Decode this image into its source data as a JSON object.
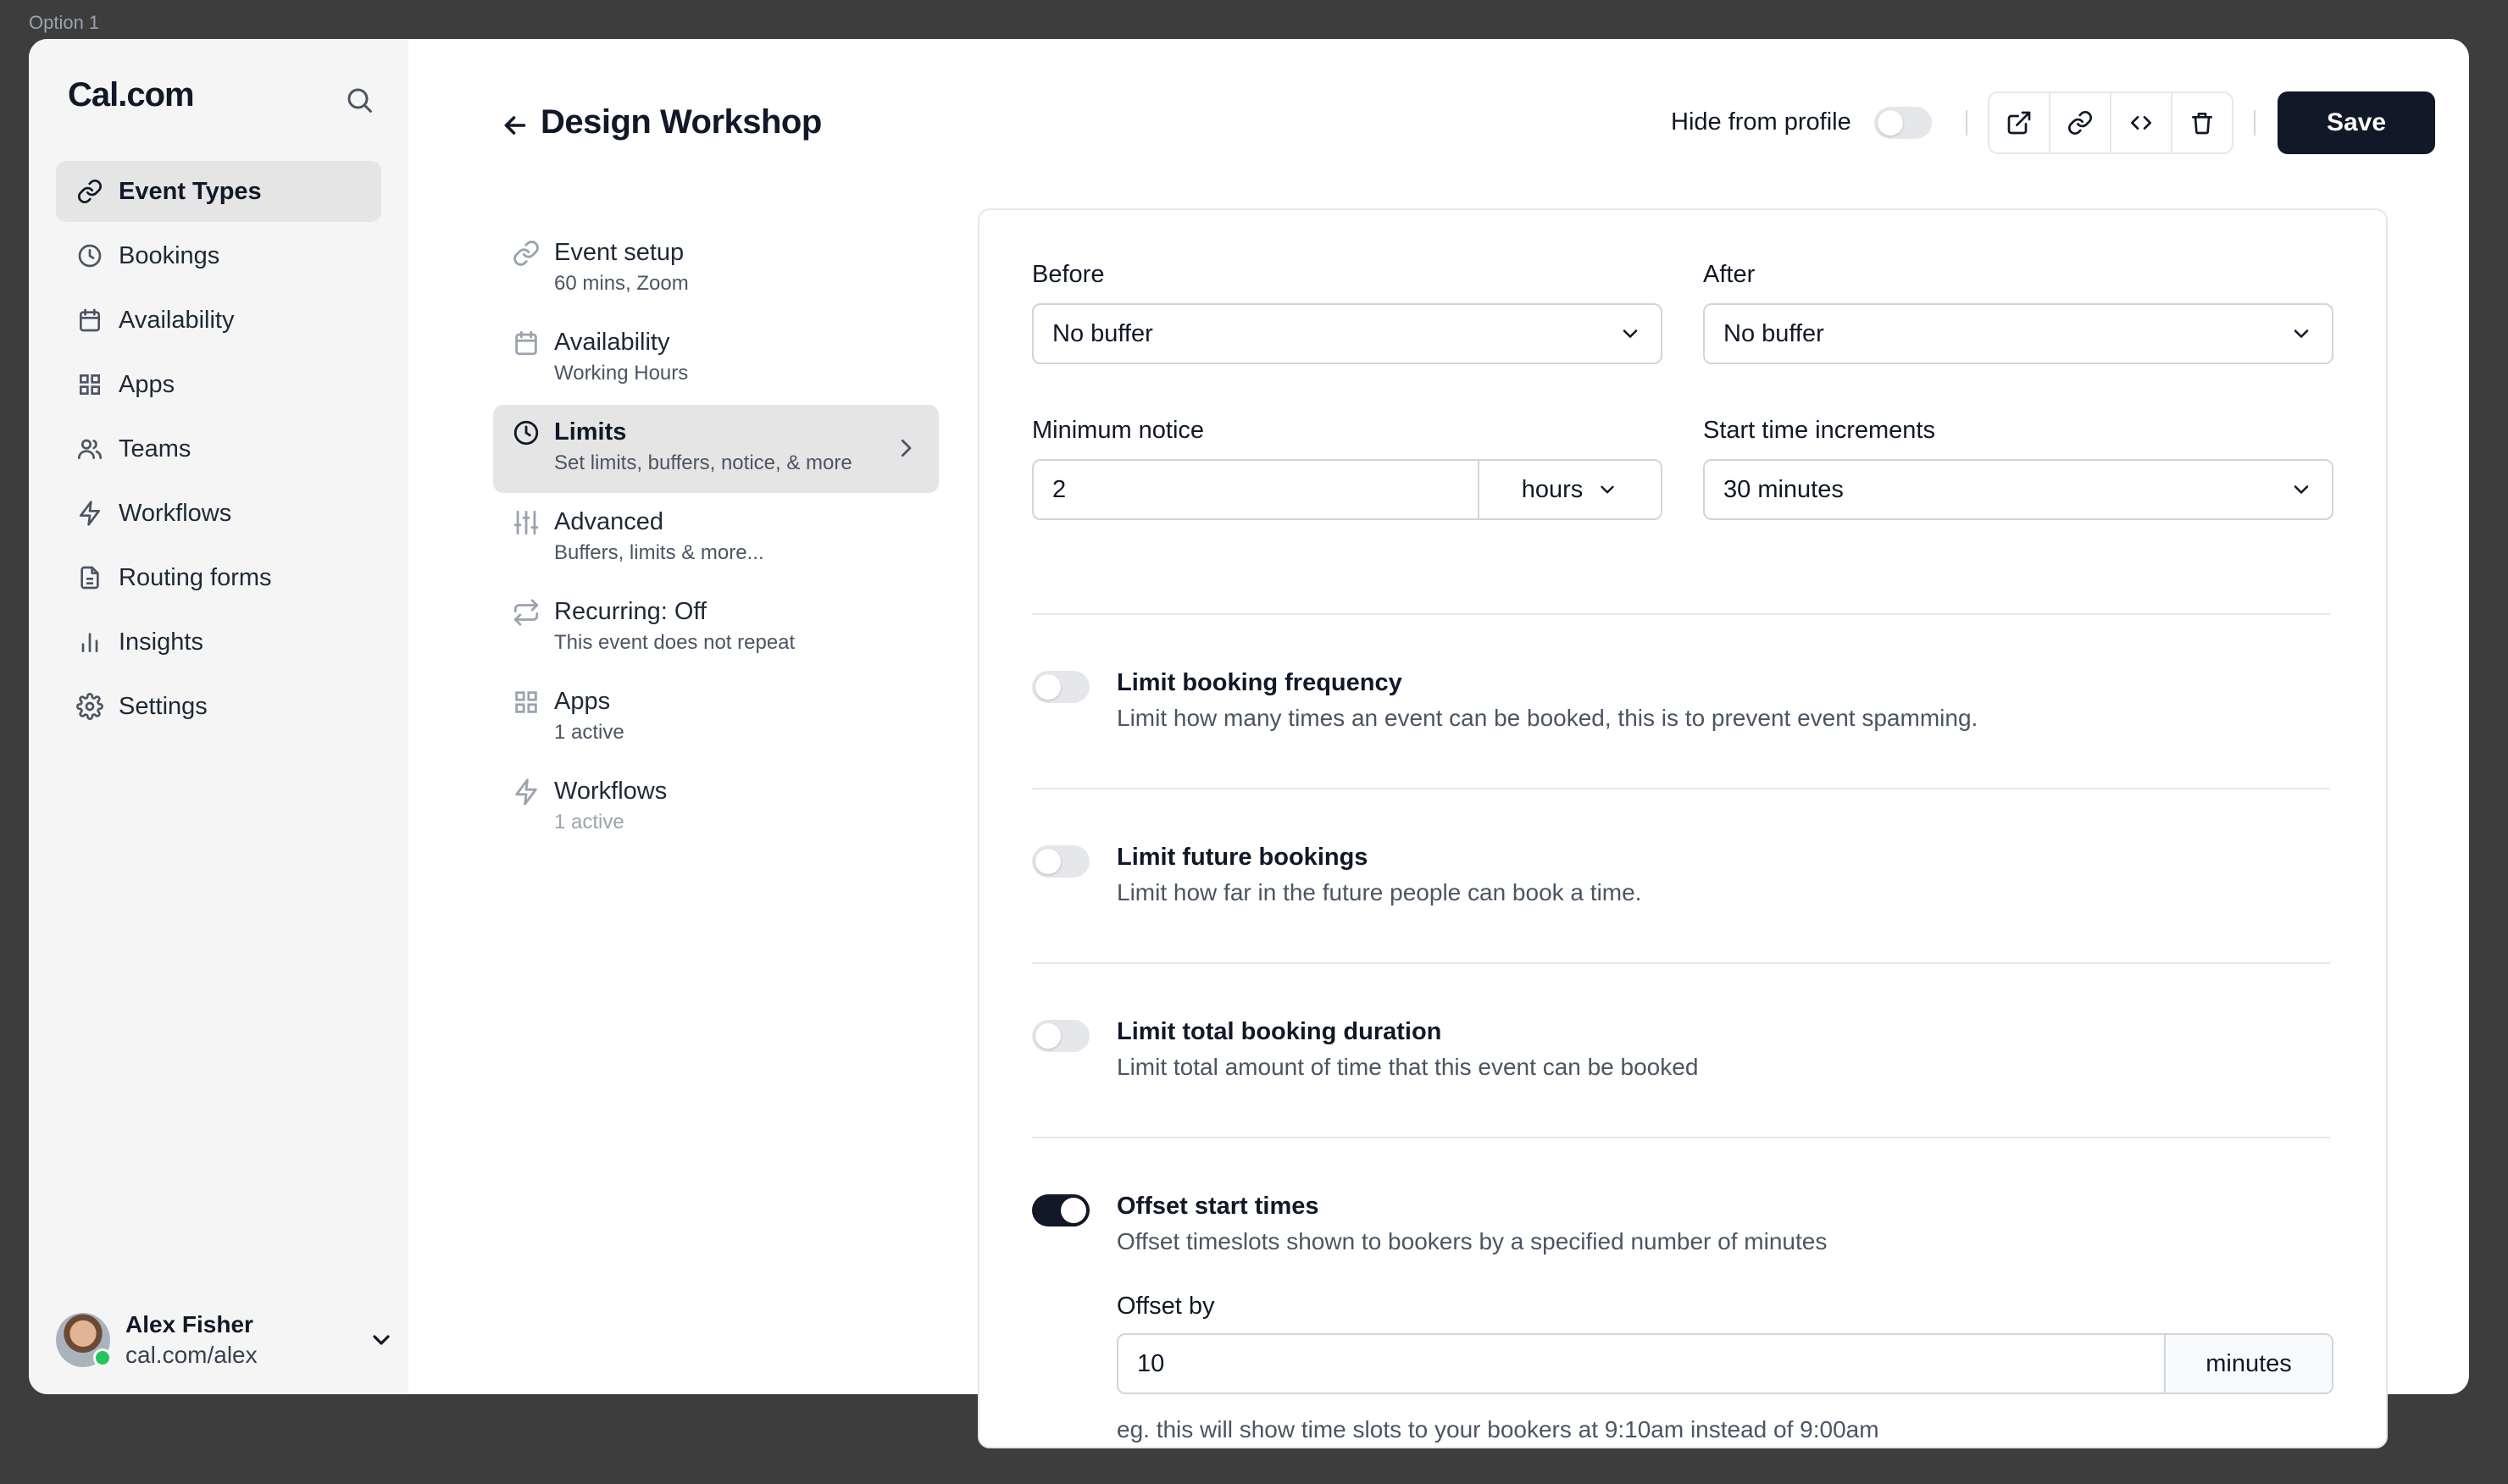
{
  "frame_label": "Option 1",
  "app": {
    "logo": "Cal.com"
  },
  "sidebar": {
    "items": [
      {
        "label": "Event Types",
        "icon": "link-icon",
        "active": true
      },
      {
        "label": "Bookings",
        "icon": "clock-icon"
      },
      {
        "label": "Availability",
        "icon": "calendar-icon"
      },
      {
        "label": "Apps",
        "icon": "grid-icon"
      },
      {
        "label": "Teams",
        "icon": "users-icon"
      },
      {
        "label": "Workflows",
        "icon": "zap-icon"
      },
      {
        "label": "Routing forms",
        "icon": "file-icon"
      },
      {
        "label": "Insights",
        "icon": "bar-chart-icon"
      },
      {
        "label": "Settings",
        "icon": "gear-icon"
      }
    ],
    "user": {
      "name": "Alex Fisher",
      "handle": "cal.com/alex",
      "status_color": "#22c55e"
    }
  },
  "header": {
    "title": "Design Workshop",
    "hide_from_profile_label": "Hide from profile",
    "hide_from_profile_on": false,
    "actions": [
      "external-link-icon",
      "link-icon",
      "code-icon",
      "trash-icon"
    ],
    "save_label": "Save"
  },
  "settings_nav": [
    {
      "title": "Event setup",
      "subtitle": "60 mins, Zoom",
      "icon": "link-icon"
    },
    {
      "title": "Availability",
      "subtitle": "Working Hours",
      "icon": "calendar-icon"
    },
    {
      "title": "Limits",
      "subtitle": "Set limits, buffers, notice, & more",
      "icon": "clock-icon",
      "active": true
    },
    {
      "title": "Advanced",
      "subtitle": "Buffers, limits & more...",
      "icon": "sliders-icon"
    },
    {
      "title": "Recurring: Off",
      "subtitle": "This event does not repeat",
      "icon": "repeat-icon"
    },
    {
      "title": "Apps",
      "subtitle": "1 active",
      "icon": "grid-icon"
    },
    {
      "title": "Workflows",
      "subtitle": "1 active",
      "icon": "zap-icon"
    }
  ],
  "limits": {
    "before_label": "Before",
    "before_value": "No buffer",
    "after_label": "After",
    "after_value": "No buffer",
    "min_notice_label": "Minimum notice",
    "min_notice_value": "2",
    "min_notice_unit": "hours",
    "increments_label": "Start time increments",
    "increments_value": "30 minutes",
    "options": [
      {
        "title": "Limit booking frequency",
        "description": "Limit how many times an event can be booked, this is to prevent event spamming.",
        "enabled": false
      },
      {
        "title": "Limit future bookings",
        "description": "Limit how far in the future people can book a time.",
        "enabled": false
      },
      {
        "title": "Limit total booking duration",
        "description": "Limit total amount of time that this event can be booked",
        "enabled": false
      },
      {
        "title": "Offset start times",
        "description": "Offset timeslots shown to bookers by a specified number of minutes",
        "enabled": true
      }
    ],
    "offset_label": "Offset by",
    "offset_value": "10",
    "offset_unit": "minutes",
    "offset_hint": "eg. this will show time slots to your bookers at 9:10am instead of 9:00am"
  },
  "colors": {
    "primary": "#111827",
    "sidebar_bg": "#f5f5f5",
    "border": "#e5e7eb",
    "backdrop": "#3d3d3d"
  }
}
